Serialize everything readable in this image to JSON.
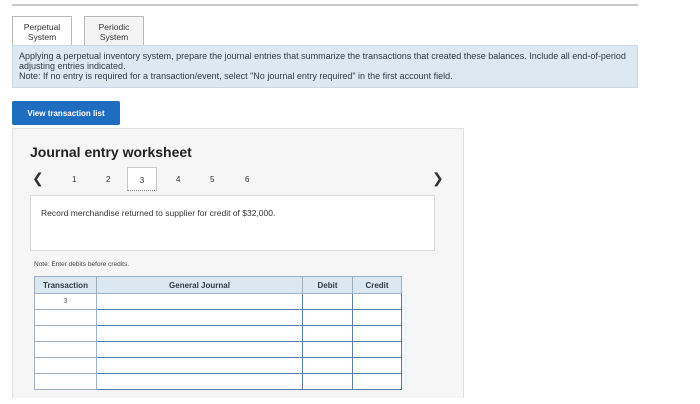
{
  "tabs": [
    {
      "label_line1": "Perpetual",
      "label_line2": "System"
    },
    {
      "label_line1": "Periodic",
      "label_line2": "System"
    }
  ],
  "instructions": {
    "line1": "Applying a perpetual inventory system, prepare the journal entries that summarize the transactions that created these balances. Include all end-of-period adjusting entries indicated.",
    "note": "Note: If no entry is required for a transaction/event, select \"No journal entry required\" in the first account field."
  },
  "view_button_label": "View transaction list",
  "worksheet": {
    "title": "Journal entry worksheet",
    "pages": [
      "1",
      "2",
      "3",
      "4",
      "5",
      "6"
    ],
    "current_page": "3",
    "prompt": "Record merchandise returned to supplier for credit of $32,000.",
    "note": "Note: Enter debits before credits.",
    "table": {
      "headers": {
        "transaction": "Transaction",
        "account": "General Journal",
        "debit": "Debit",
        "credit": "Credit"
      },
      "transaction_number": "3",
      "row_count": 6
    }
  },
  "icons": {
    "prev": "chevron-left-icon",
    "next": "chevron-right-icon"
  }
}
